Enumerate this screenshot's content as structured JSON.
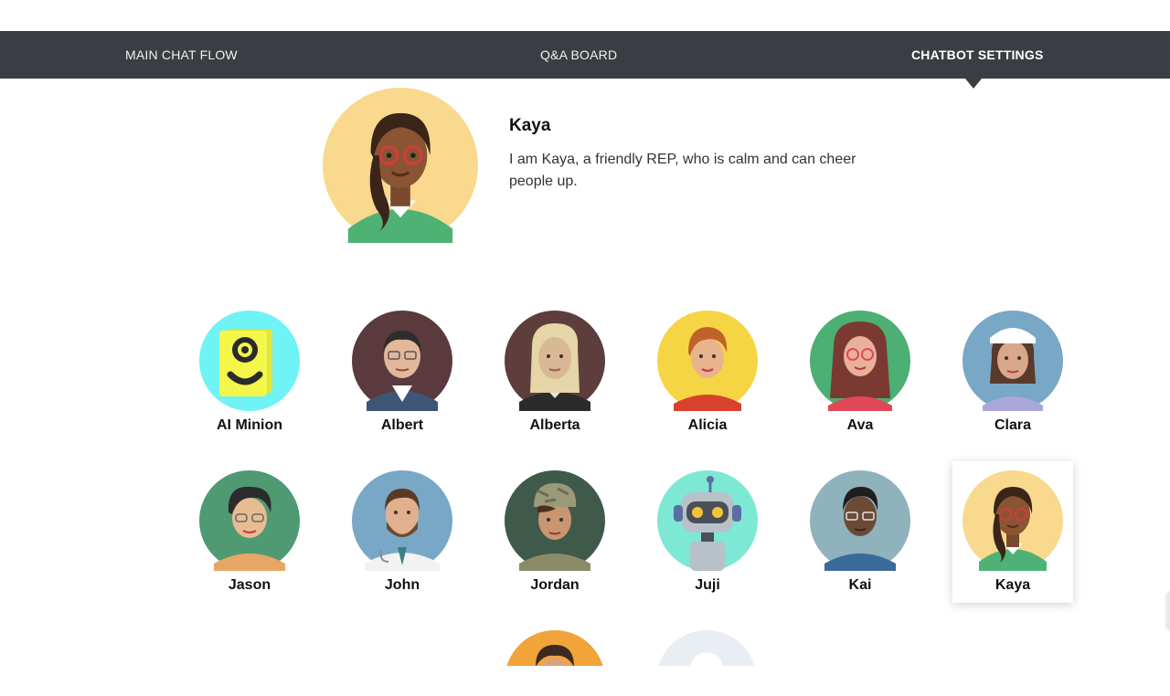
{
  "nav": {
    "tabs": [
      {
        "label": "MAIN CHAT FLOW"
      },
      {
        "label": "Q&A BOARD"
      },
      {
        "label": "CHATBOT SETTINGS",
        "active": true
      }
    ]
  },
  "profile": {
    "name": "Kaya",
    "description": "I am Kaya, a friendly REP, who is calm and can cheer people up."
  },
  "avatars": [
    {
      "name": "AI Minion",
      "bg": "#6ff3f5"
    },
    {
      "name": "Albert",
      "bg": "#5a3a3c"
    },
    {
      "name": "Alberta",
      "bg": "#5e3d3d"
    },
    {
      "name": "Alicia",
      "bg": "#f6d544"
    },
    {
      "name": "Ava",
      "bg": "#4caf73"
    },
    {
      "name": "Clara",
      "bg": "#79a7c6"
    },
    {
      "name": "Jason",
      "bg": "#4f9a73"
    },
    {
      "name": "John",
      "bg": "#79a7c6"
    },
    {
      "name": "Jordan",
      "bg": "#3f5a4a"
    },
    {
      "name": "Juji",
      "bg": "#7de8d4"
    },
    {
      "name": "Kai",
      "bg": "#8fb2bd"
    },
    {
      "name": "Kaya",
      "bg": "#f8d98d",
      "selected": true
    }
  ],
  "partial_avatars": [
    {
      "name": "orange-avatar",
      "bg": "#f1a43a"
    },
    {
      "name": "placeholder-avatar",
      "bg": "#e9edf4"
    }
  ]
}
